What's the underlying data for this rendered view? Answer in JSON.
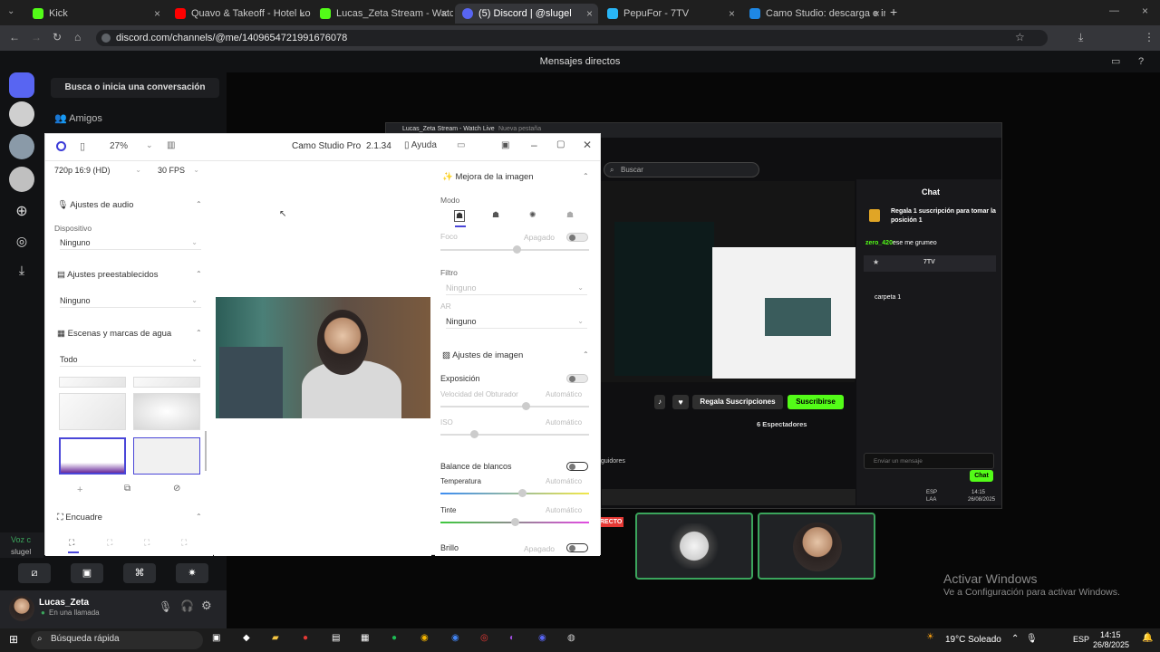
{
  "browser": {
    "tabs": [
      {
        "label": "Kick",
        "color": "#53fc18"
      },
      {
        "label": "Quavo & Takeoff - Hotel Lo",
        "color": "#ff0000"
      },
      {
        "label": "Lucas_Zeta Stream - Watch Live",
        "color": "#53fc18"
      },
      {
        "label": "(5) Discord | @slugel",
        "color": "#5865f2"
      },
      {
        "label": "PepuFor - 7TV",
        "color": "#29b6f6"
      },
      {
        "label": "Camo Studio: descarga e instal",
        "color": "#1e88e5"
      }
    ],
    "url": "discord.com/channels/@me/1409654721991676078",
    "new_tab": "+"
  },
  "discord": {
    "header": "Mensajes directos",
    "search": "Busca o inicia una conversación",
    "friends": "Amigos",
    "voice_status": "Voz c",
    "voice_user": "slugel",
    "username": "Lucas_Zeta",
    "user_status": "En una llamada"
  },
  "camo": {
    "zoom": "27%",
    "app_name": "Camo Studio Pro",
    "version": "2.1.34",
    "help": "Ayuda",
    "resolution": "720p 16:9 (HD)",
    "fps": "30 FPS",
    "audio": {
      "title": "Ajustes de audio",
      "device_label": "Dispositivo",
      "device_value": "Ninguno"
    },
    "presets": {
      "title": "Ajustes preestablecidos",
      "value": "Ninguno"
    },
    "scenes": {
      "title": "Escenas y marcas de agua",
      "value": "Todo"
    },
    "framing": {
      "title": "Encuadre"
    },
    "enhance": {
      "title": "Mejora de la imagen",
      "mode_label": "Modo",
      "focus_label": "Foco",
      "focus_state": "Apagado",
      "filter_label": "Filtro",
      "filter_value": "Ninguno",
      "ar_label": "AR",
      "ar_value": "Ninguno"
    },
    "image": {
      "title": "Ajustes de imagen",
      "exposure": "Exposición",
      "shutter": "Velocidad del Obturador",
      "shutter_state": "Automático",
      "iso": "ISO",
      "iso_state": "Automático",
      "wb": "Balance de blancos",
      "temp": "Temperatura",
      "temp_state": "Automático",
      "tint": "Tinte",
      "tint_state": "Automático",
      "brightness": "Brillo",
      "brightness_state": "Apagado"
    }
  },
  "stream": {
    "tab1": "Lucas_Zeta Stream - Watch Live",
    "tab2": "Nueva pestaña",
    "search": "Buscar",
    "chat_title": "Chat",
    "gift_msg": "Regala 1 suscripción para tomar la posición 1",
    "chat_line_user": "zero_420:",
    "chat_line_text": "ese me grumeo",
    "tab_7tv": "7TV",
    "folder": "carpeta 1",
    "gift_btn": "Regala Suscripciones",
    "sub_btn": "Suscribirse",
    "viewers": "6 Espectadores",
    "followers": "guidores",
    "chat_placeholder": "Enviar un mensaje",
    "chat_btn": "Chat",
    "live_tag": "RECTO",
    "tray_lang": "ESP",
    "tray_region": "LAA",
    "tray_time": "14:15",
    "tray_date": "26/08/2025"
  },
  "watermark": {
    "title": "Activar Windows",
    "subtitle": "Ve a Configuración para activar Windows."
  },
  "taskbar": {
    "search": "Búsqueda rápida",
    "weather": "19°C Soleado",
    "lang": "ESP",
    "time": "14:15",
    "date": "26/8/2025"
  }
}
